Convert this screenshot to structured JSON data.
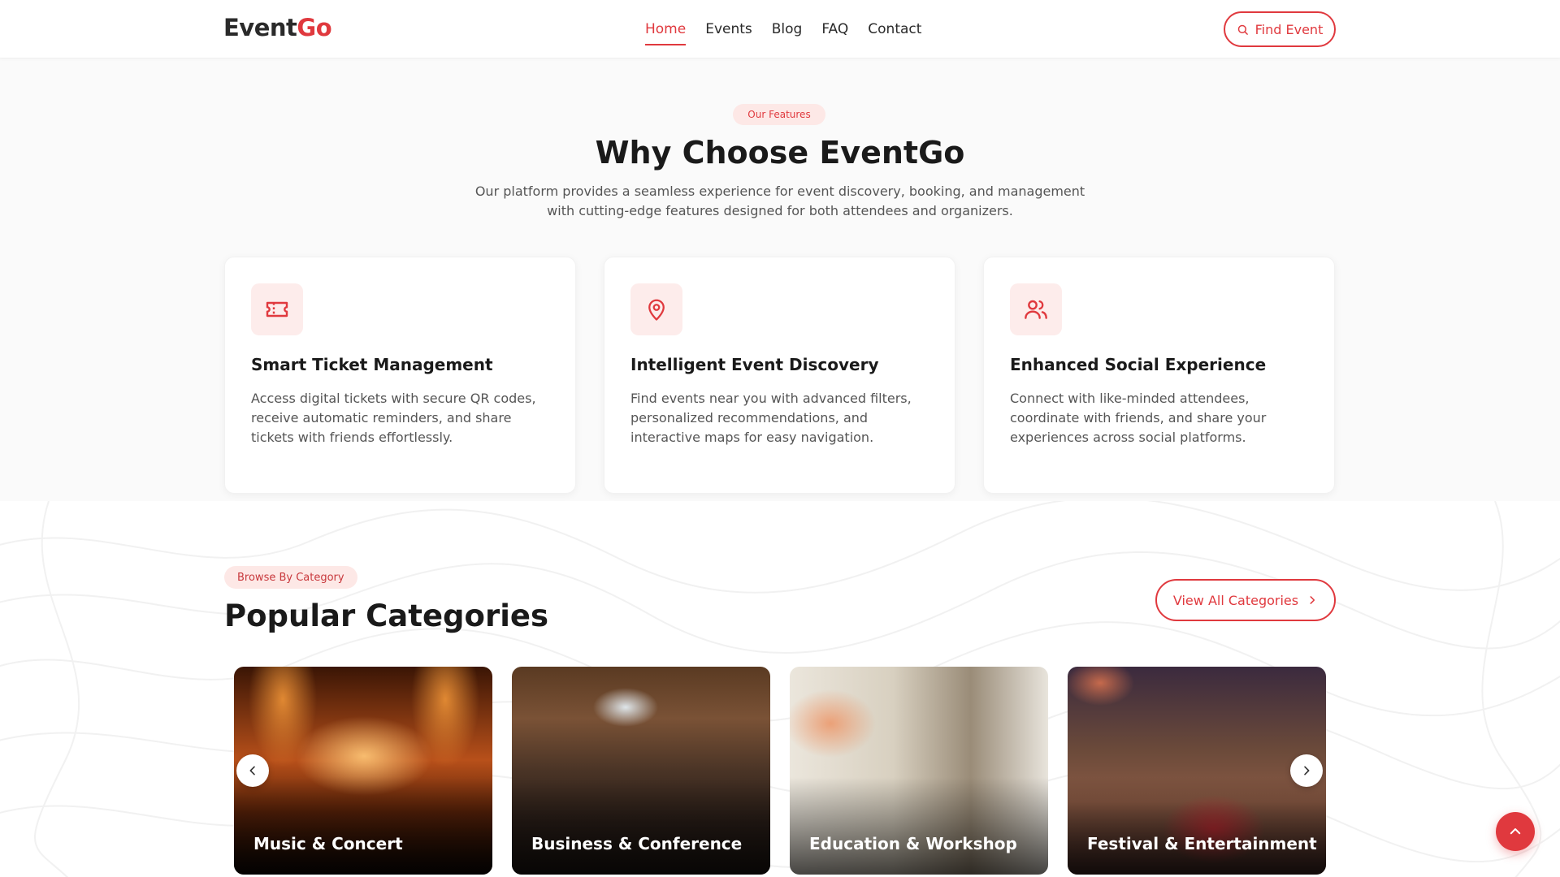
{
  "brand": {
    "logo_main": "Event",
    "logo_accent": "Go",
    "accent_color": "#e0393e"
  },
  "nav": {
    "items": [
      {
        "label": "Home",
        "active": true
      },
      {
        "label": "Events",
        "active": false
      },
      {
        "label": "Blog",
        "active": false
      },
      {
        "label": "FAQ",
        "active": false
      },
      {
        "label": "Contact",
        "active": false
      }
    ],
    "find_event": {
      "label": "Find Event",
      "icon": "search-icon"
    }
  },
  "features": {
    "pill": "Our Features",
    "title": "Why Choose EventGo",
    "subtitle": "Our platform provides a seamless experience for event discovery, booking, and management with cutting-edge features designed for both attendees and organizers.",
    "cards": [
      {
        "icon": "ticket-icon",
        "title": "Smart Ticket Management",
        "text": "Access digital tickets with secure QR codes, receive automatic reminders, and share tickets with friends effortlessly."
      },
      {
        "icon": "map-pin-icon",
        "title": "Intelligent Event Discovery",
        "text": "Find events near you with advanced filters, personalized recommendations, and interactive maps for easy navigation."
      },
      {
        "icon": "users-icon",
        "title": "Enhanced Social Experience",
        "text": "Connect with like-minded attendees, coordinate with friends, and share your experiences across social platforms."
      }
    ]
  },
  "categories": {
    "pill": "Browse By Category",
    "title": "Popular Categories",
    "view_all": {
      "label": "View All Categories",
      "icon": "chevron-right-icon"
    },
    "items": [
      {
        "label": "Music & Concert"
      },
      {
        "label": "Business & Conference"
      },
      {
        "label": "Education & Workshop"
      },
      {
        "label": "Festival & Entertainment"
      }
    ],
    "prev_icon": "chevron-left-icon",
    "next_icon": "chevron-right-icon"
  },
  "scroll_top": {
    "icon": "chevron-up-icon"
  }
}
